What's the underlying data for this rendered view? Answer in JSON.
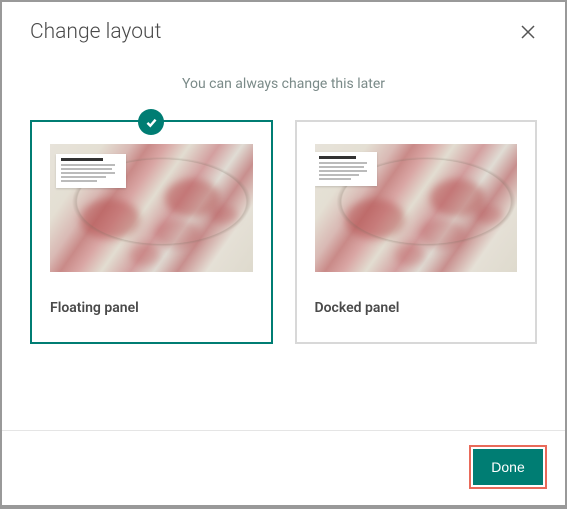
{
  "dialog": {
    "title": "Change layout",
    "subtitle": "You can always change this later",
    "closeIconName": "close-icon"
  },
  "options": [
    {
      "id": "floating",
      "label": "Floating panel",
      "selected": true
    },
    {
      "id": "docked",
      "label": "Docked panel",
      "selected": false
    }
  ],
  "actions": {
    "doneLabel": "Done"
  },
  "colors": {
    "accent": "#007d73",
    "highlight": "#e96a5a"
  }
}
